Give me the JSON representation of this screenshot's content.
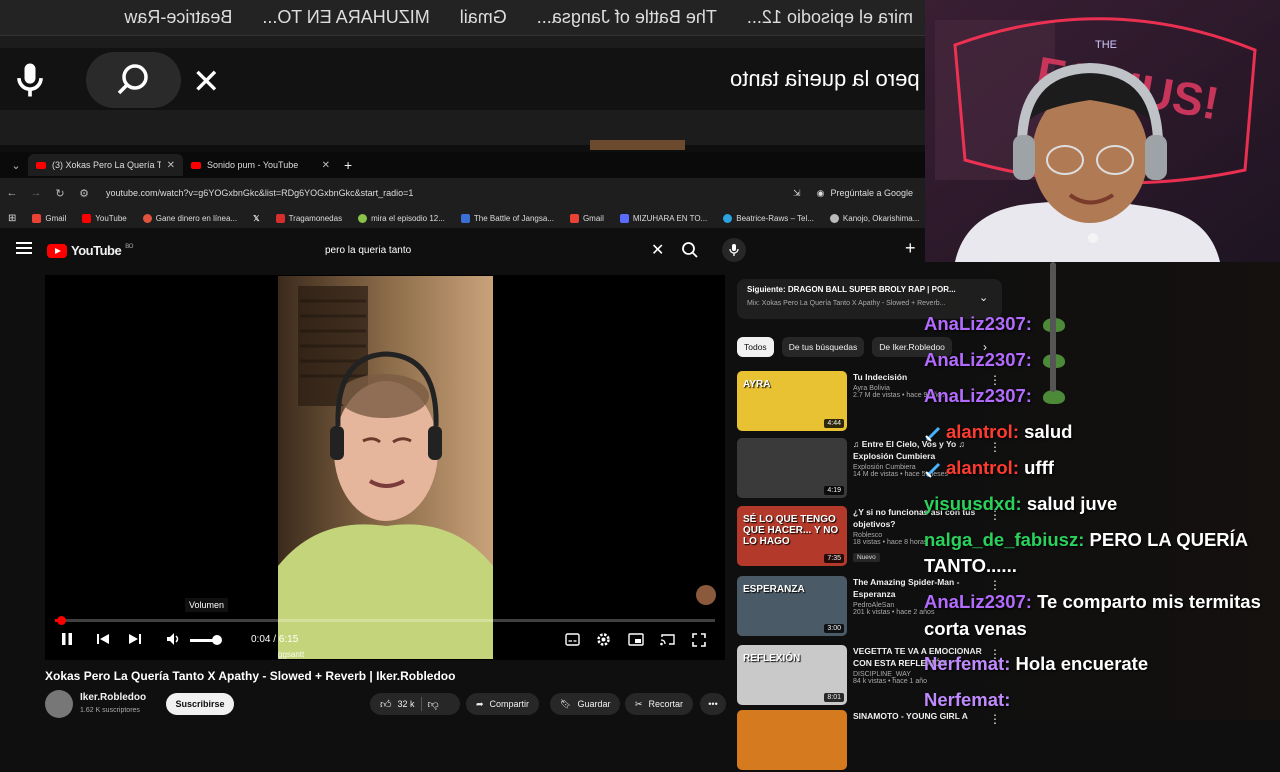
{
  "mirrored_overlay": {
    "bookmarks": [
      "Beatrice-Raw",
      "MIZUHARA EN TO...",
      "Gmail",
      "The Battle of Jangsa...",
      "mira el episodio 12..."
    ],
    "search_query": "pero la queria tanto"
  },
  "browser": {
    "tabs": [
      {
        "label": "(3) Xokas Pero La Quería Ta",
        "active": true
      },
      {
        "label": "Sonido pum - YouTube",
        "active": false
      }
    ],
    "new_tab": "+",
    "url": "youtube.com/watch?v=g6YOGxbnGkc&list=RDg6YOGxbnGkc&start_radio=1",
    "ask_google": "Pregúntale a Google",
    "bookmarks": [
      {
        "label": "Gmail",
        "color": "#ea4335"
      },
      {
        "label": "YouTube",
        "color": "#ff0000"
      },
      {
        "label": "Gane dinero en línea...",
        "color": "#e0533d"
      },
      {
        "label": "",
        "color": "#ffffff"
      },
      {
        "label": "Tragamonedas",
        "color": "#d62d2d"
      },
      {
        "label": "mira el episodio 12...",
        "color": "#8ac34a"
      },
      {
        "label": "The Battle of Jangsa...",
        "color": "#3b6fd6"
      },
      {
        "label": "Gmail",
        "color": "#ea4335"
      },
      {
        "label": "MIZUHARA EN TO...",
        "color": "#5a6bff"
      },
      {
        "label": "Beatrice-Raws – Tel...",
        "color": "#2aa3e0"
      },
      {
        "label": "Kanojo, Okarishima...",
        "color": "#bbbbbb"
      }
    ]
  },
  "youtube": {
    "logo_text": "YouTube",
    "country": "BO",
    "search_value": "pero la queria tanto",
    "player": {
      "volume_tooltip": "Volumen",
      "time": "0:04 / 6:15",
      "progress": 0.011
    },
    "video": {
      "title": "Xokas Pero La Quería Tanto X Apathy - Slowed + Reverb | Iker.Robledoo",
      "channel": "Iker.Robledoo",
      "subscribers": "1.62 K suscriptores",
      "subscribe_label": "Suscribirse",
      "likes": "32 k",
      "share_label": "Compartir",
      "save_label": "Guardar",
      "clip_label": "Recortar"
    },
    "up_next": {
      "line1": "Siguiente: DRAGON BALL SUPER BROLY RAP | POR...",
      "line2": "Mix: Xokas Pero La Quería Tanto X Apathy - Slowed + Reverb..."
    },
    "chips": [
      "Todos",
      "De tus búsquedas",
      "De Iker.Robledoo"
    ],
    "recommendations": [
      {
        "title": "Tu Indecisión",
        "channel": "Ayra Bolivia",
        "meta": "2.7 M de vistas • hace 9 años",
        "duration": "4:44",
        "thumb_color": "#e8c232",
        "thumb_text": "AYRA"
      },
      {
        "title": "♫ Entre El Cielo, Vos y Yo ♫ Explosión Cumbiera",
        "channel": "Explosión Cumbiera",
        "meta": "14 M de vistas • hace 5 meses",
        "duration": "4:19",
        "thumb_color": "#3a3a3a",
        "thumb_text": ""
      },
      {
        "title": "¿Y si no funcionas así con tus objetivos?",
        "channel": "Roblesco",
        "meta": "18 vistas • hace 8 horas",
        "duration": "7:35",
        "thumb_color": "#b33a2a",
        "thumb_text": "SÉ LO QUE TENGO QUE HACER... Y NO LO HAGO",
        "badge": "Nuevo"
      },
      {
        "title": "The Amazing Spider-Man - Esperanza",
        "channel": "PedroAleSan",
        "meta": "201 k vistas • hace 2 años",
        "duration": "3:00",
        "thumb_color": "#4a5a66",
        "thumb_text": "ESPERANZA"
      },
      {
        "title": "VEGETTA TE VA A EMOCIONAR CON ESTA REFLEXIÓN",
        "channel": "DISCIPLINE_WAY",
        "meta": "84 k vistas • hace 1 año",
        "duration": "8:01",
        "thumb_color": "#c9c9c9",
        "thumb_text": "REFLEXIÓN"
      },
      {
        "title": "SINAMOTO - YOUNG GIRL A",
        "channel": "",
        "meta": "",
        "duration": "",
        "thumb_color": "#d67a20",
        "thumb_text": ""
      }
    ]
  },
  "webcam": {
    "sign_text": "FABIUS!",
    "sign_small": "THE"
  },
  "chat": [
    {
      "user": "AnaLiz2307:",
      "text": "",
      "emote": true,
      "user_color": "#b36bff"
    },
    {
      "user": "AnaLiz2307:",
      "text": "",
      "emote": true,
      "user_color": "#b36bff"
    },
    {
      "user": "AnaLiz2307:",
      "text": "",
      "emote": true,
      "user_color": "#b36bff"
    },
    {
      "user": "alantrol:",
      "text": "salud",
      "emote": false,
      "user_color": "#ff3b30"
    },
    {
      "user": "alantrol:",
      "text": "ufff",
      "emote": false,
      "user_color": "#ff3b30"
    },
    {
      "user": "yisuusdxd:",
      "text": "salud juve",
      "emote": false,
      "user_color": "#2ad15a"
    },
    {
      "user": "nalga_de_fabiusz:",
      "text": "PERO LA QUERÍA",
      "emote": false,
      "user_color": "#2ad15a"
    },
    {
      "user": "",
      "text": "TANTO......",
      "emote": false,
      "user_color": "#ffffff"
    },
    {
      "user": "AnaLiz2307:",
      "text": "Te comparto mis termitas",
      "emote": false,
      "user_color": "#b36bff"
    },
    {
      "user": "",
      "text": "corta venas",
      "emote": false,
      "user_color": "#ffffff"
    },
    {
      "user": "Nerfemat:",
      "text": "Hola encuerate",
      "emote": false,
      "user_color": "#c08aff"
    },
    {
      "user": "Nerfemat:",
      "text": "",
      "emote": false,
      "user_color": "#c08aff"
    }
  ]
}
